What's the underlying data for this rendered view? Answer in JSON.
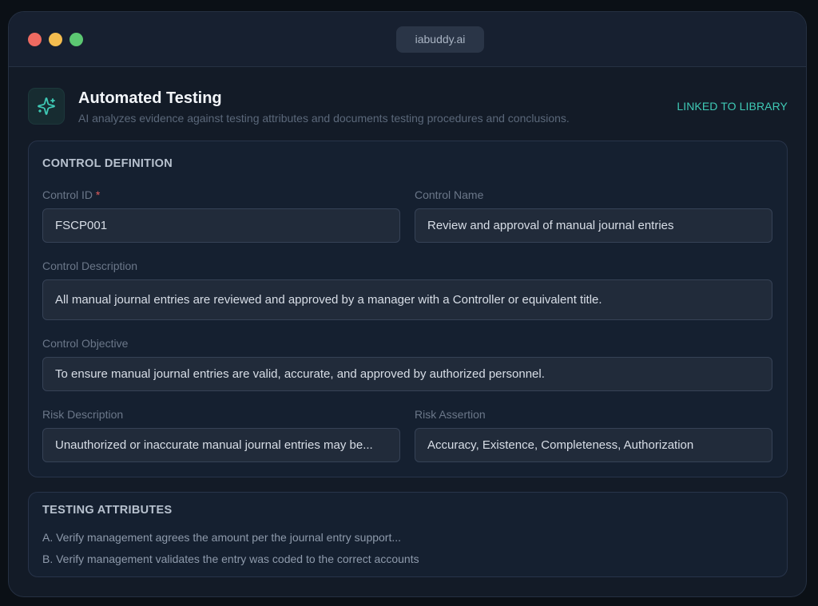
{
  "window": {
    "url": "iabuddy.ai"
  },
  "header": {
    "icon": "sparkles-icon",
    "title": "Automated Testing",
    "subtitle": "AI analyzes evidence against testing attributes and documents testing procedures and conclusions.",
    "status": "LINKED TO LIBRARY"
  },
  "control_definition": {
    "heading": "CONTROL DEFINITION",
    "control_id": {
      "label": "Control ID",
      "required_marker": "*",
      "value": "FSCP001"
    },
    "control_name": {
      "label": "Control Name",
      "value": "Review and approval of manual journal entries"
    },
    "control_description": {
      "label": "Control Description",
      "value": "All manual journal entries are reviewed and approved by a manager with a Controller or equivalent title."
    },
    "control_objective": {
      "label": "Control Objective",
      "value": "To ensure manual journal entries are valid, accurate, and approved by authorized personnel."
    },
    "risk_description": {
      "label": "Risk Description",
      "value": "Unauthorized or inaccurate manual journal entries may be..."
    },
    "risk_assertion": {
      "label": "Risk Assertion",
      "value": "Accuracy, Existence, Completeness, Authorization"
    }
  },
  "testing_attributes": {
    "heading": "TESTING ATTRIBUTES",
    "items": [
      "A. Verify management agrees the amount per the journal entry support...",
      "B. Verify management validates the entry was coded to the correct accounts"
    ]
  },
  "colors": {
    "accent": "#3fcab6",
    "required": "#e25c5c",
    "light-close": "#ee6a61",
    "light-minimize": "#f4bd4f",
    "light-maximize": "#5cc872"
  }
}
